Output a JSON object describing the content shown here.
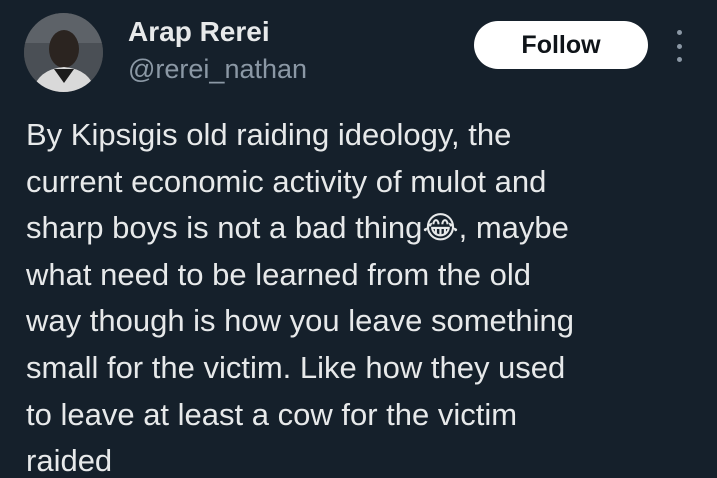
{
  "author": {
    "display_name": "Arap Rerei",
    "handle": "@rerei_nathan",
    "avatar_icon": "profile-photo"
  },
  "actions": {
    "follow_label": "Follow",
    "more_icon": "more-vertical-icon"
  },
  "tweet": {
    "text": "By Kipsigis old raiding ideology, the\ncurrent economic activity of mulot and\nsharp boys is not a bad thing😂, maybe\nwhat need to be learned from the old\nway though is how you leave something\nsmall for the victim. Like how they used\nto leave at least a cow for the victim\nraided"
  },
  "colors": {
    "background": "#15202b",
    "primary_text": "#e7e9ea",
    "secondary_text": "#8b98a5",
    "follow_bg": "#ffffff",
    "follow_text": "#0f1419"
  }
}
